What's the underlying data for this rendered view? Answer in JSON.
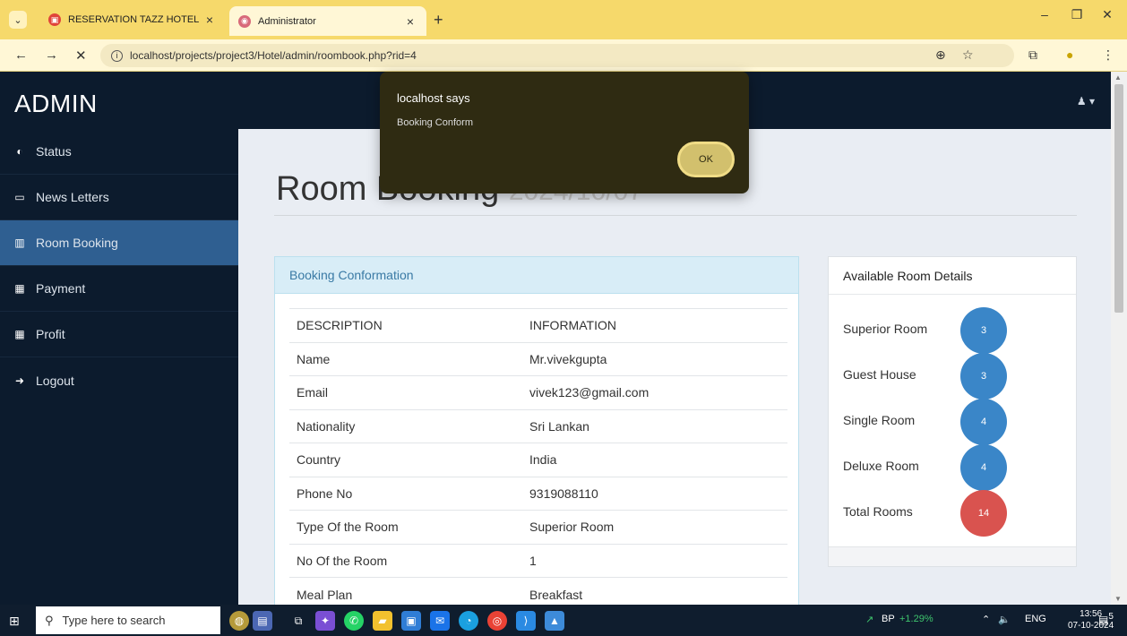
{
  "browser": {
    "tabs": [
      {
        "label": "RESERVATION TAZZ HOTEL"
      },
      {
        "label": "Administrator"
      }
    ],
    "url": "localhost/projects/project3/Hotel/admin/roombook.php?rid=4"
  },
  "app": {
    "brand": "ADMIN",
    "sidebar": [
      {
        "label": "Status",
        "icon": "dashboard-icon"
      },
      {
        "label": "News Letters",
        "icon": "desktop-icon"
      },
      {
        "label": "Room Booking",
        "icon": "bar-chart-icon"
      },
      {
        "label": "Payment",
        "icon": "qrcode-icon"
      },
      {
        "label": "Profit",
        "icon": "qrcode-icon"
      },
      {
        "label": "Logout",
        "icon": "sign-out-icon"
      }
    ],
    "page_title": "Room Booking",
    "page_date": "2024/10/07",
    "booking_panel": {
      "heading": "Booking Conformation",
      "col_description": "DESCRIPTION",
      "col_information": "INFORMATION",
      "rows": [
        {
          "label": "Name",
          "value": "Mr.vivekgupta"
        },
        {
          "label": "Email",
          "value": "vivek123@gmail.com"
        },
        {
          "label": "Nationality",
          "value": "Sri Lankan"
        },
        {
          "label": "Country",
          "value": "India"
        },
        {
          "label": "Phone No",
          "value": "9319088110"
        },
        {
          "label": "Type Of the Room",
          "value": "Superior Room"
        },
        {
          "label": "No Of the Room",
          "value": "1"
        },
        {
          "label": "Meal Plan",
          "value": "Breakfast"
        }
      ]
    },
    "available_panel": {
      "heading": "Available Room Details",
      "rows": [
        {
          "label": "Superior Room",
          "count": "3",
          "color": "#3a86c8"
        },
        {
          "label": "Guest House",
          "count": "3",
          "color": "#3a86c8"
        },
        {
          "label": "Single Room",
          "count": "4",
          "color": "#3a86c8"
        },
        {
          "label": "Deluxe Room",
          "count": "4",
          "color": "#3a86c8"
        },
        {
          "label": "Total Rooms",
          "count": "14",
          "color": "#d9534f"
        }
      ]
    }
  },
  "dialog": {
    "title": "localhost says",
    "message": "Booking Conform",
    "ok_label": "OK"
  },
  "taskbar": {
    "search_placeholder": "Type here to search",
    "stock_label": "BP",
    "stock_change": "+1.29%",
    "language": "ENG",
    "time": "13:56",
    "date": "07-10-2024",
    "notification_count": "5"
  }
}
